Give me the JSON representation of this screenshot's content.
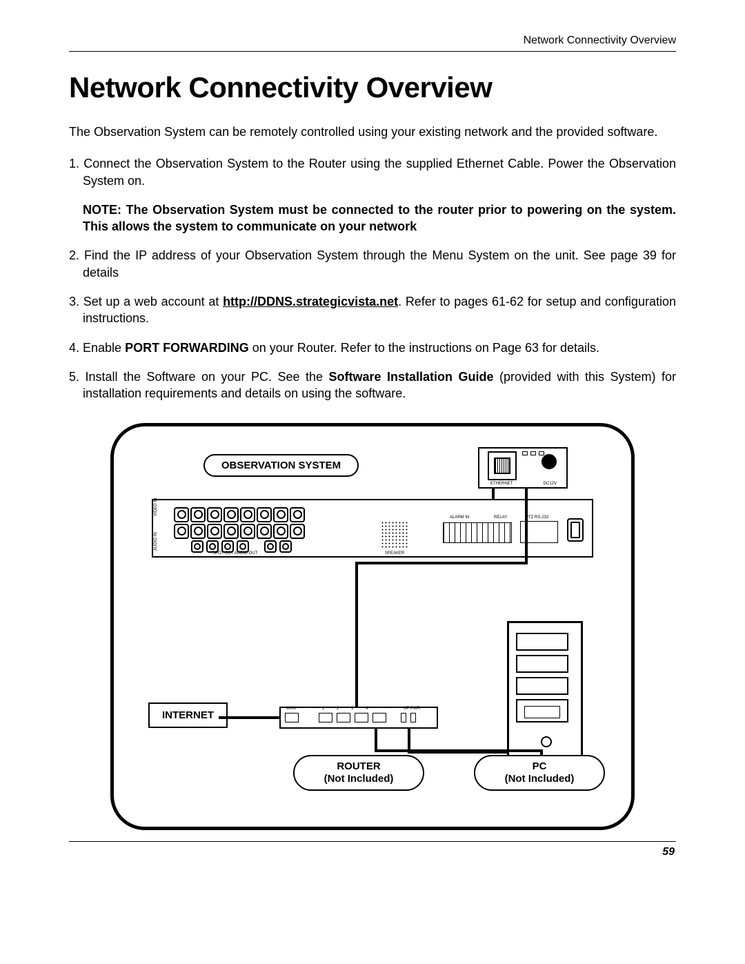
{
  "running_header": "Network Connectivity Overview",
  "title": "Network Connectivity Overview",
  "intro": "The Observation System can be remotely controlled using your existing network and the provided software.",
  "step1": "1. Connect the Observation System to the Router using the supplied Ethernet Cable. Power the Observation System on.",
  "note": "NOTE: The Observation System must be connected to the router prior to powering on the system. This allows the system to communicate on your network",
  "step2": "2. Find the IP address of your Observation System through the Menu System on the unit. See page 39 for details",
  "step3_a": "3. Set up a web account at ",
  "step3_link": "http://DDNS.strategicvista.net",
  "step3_b": ". Refer to pages 61-62 for setup and configuration instructions.",
  "step4_a": "4. Enable ",
  "step4_bold": "PORT FORWARDING",
  "step4_b": " on your Router. Refer to the instructions on Page 63 for details.",
  "step5_a": "5. Install the Software on your PC. See the ",
  "step5_bold": "Software Installation Guide",
  "step5_b": " (provided with this System) for installation requirements and details on using the software.",
  "diagram": {
    "obs_label": "OBSERVATION SYSTEM",
    "internet_label": "INTERNET",
    "router_label_l1": "ROUTER",
    "router_label_l2": "(Not Included)",
    "pc_label_l1": "PC",
    "pc_label_l2": "(Not Included)",
    "eth_label": "ETHERNET",
    "pwr_label": "DC12V",
    "wan_label": "WAN",
    "rports": "1   2   3   4",
    "up_pwr": "UP  PWR",
    "video_in": "VIDEO IN",
    "audio_in": "AUDIO IN",
    "spot": "SPOT OUT  AUDIO OUT",
    "speaker": "SPEAKER",
    "alarm": "ALARM IN",
    "relay": "RELAY",
    "ptz": "PTZ   RS-232"
  },
  "page_number": "59"
}
